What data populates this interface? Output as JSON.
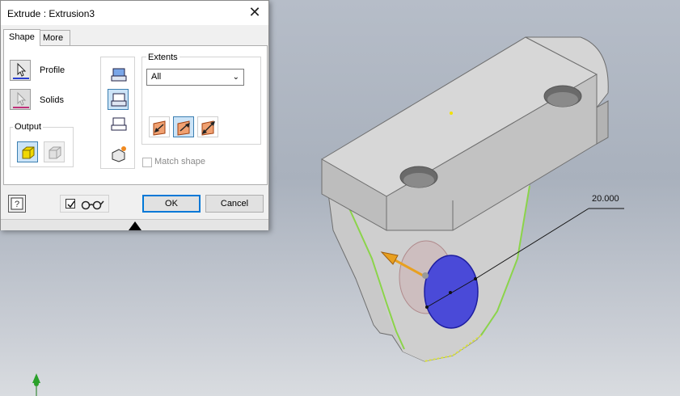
{
  "dialog": {
    "title": "Extrude : Extrusion3",
    "close_glyph": "✕",
    "tabs": [
      {
        "label": "Shape"
      },
      {
        "label": "More"
      }
    ],
    "active_tab": "Shape",
    "profile_label": "Profile",
    "solids_label": "Solids",
    "output_label": "Output",
    "extents_label": "Extents",
    "extents_value": "All",
    "match_shape_label": "Match shape",
    "match_shape_checked": false,
    "preview_checked": true,
    "ok_label": "OK",
    "cancel_label": "Cancel",
    "help_glyph": "?"
  },
  "viewport": {
    "dimension_value": "20.000",
    "accent": "#4a4ad8",
    "highlight": "#8bd44a"
  },
  "icons": {
    "profile": "cursor-arrow-icon",
    "solids": "cursor-arrow-icon",
    "output_solid": "solid-cube-icon",
    "output_surface": "surface-cube-icon",
    "op_join": "join-icon",
    "op_cut": "cut-icon",
    "op_intersect": "intersect-icon",
    "op_new_solid": "new-solid-icon",
    "dir_default": "direction-default-icon",
    "dir_flipped": "direction-flipped-icon",
    "dir_symmetric": "direction-symmetric-icon",
    "preview": "glasses-icon",
    "help": "help-icon"
  }
}
